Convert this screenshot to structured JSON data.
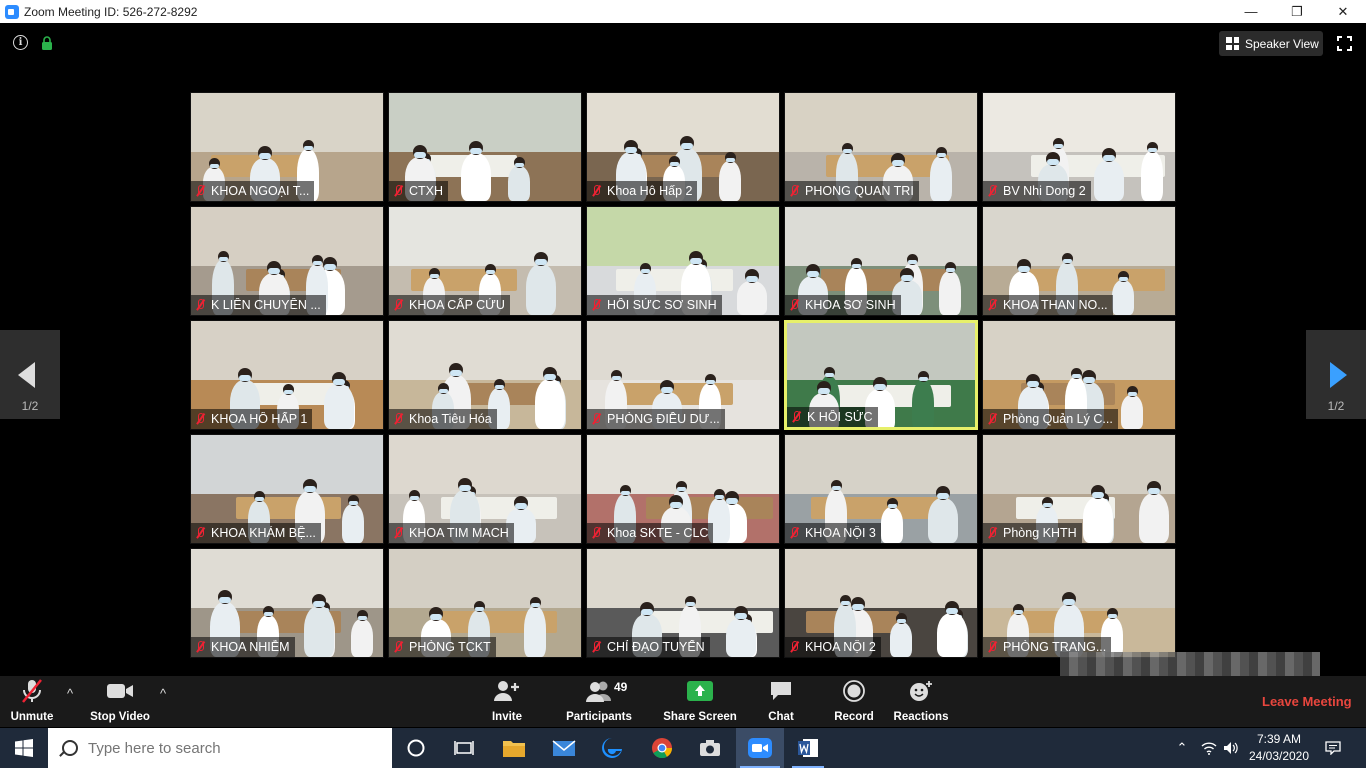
{
  "window": {
    "title": "Zoom Meeting ID: 526-272-8292",
    "controls": [
      "minimize",
      "restore",
      "close"
    ]
  },
  "top_bar": {
    "speaker_view_label": "Speaker View"
  },
  "navigation": {
    "prev_page": "1/2",
    "next_page": "1/2"
  },
  "participants_grid": [
    {
      "name": "KHOA NGOẠI T...",
      "wall": "#d9d4c8",
      "floor": "#b7a58c",
      "muted": true
    },
    {
      "name": "CTXH",
      "wall": "#c9cfc5",
      "floor": "#8d7356",
      "muted": true
    },
    {
      "name": "Khoa Hô Hấp 2",
      "wall": "#e2ddd2",
      "floor": "#7a6650",
      "muted": true
    },
    {
      "name": "PHONG QUAN TRI",
      "wall": "#d8d2c4",
      "floor": "#b9b3aa",
      "muted": true
    },
    {
      "name": "BV Nhi Dong 2",
      "wall": "#ece9e2",
      "floor": "#c5c2bd",
      "muted": true
    },
    {
      "name": "K LIÊN CHUYÊN ...",
      "wall": "#d6cfc3",
      "floor": "#a59b8e",
      "muted": true
    },
    {
      "name": "KHOA CẤP CỨU",
      "wall": "#e5e5e0",
      "floor": "#c4bcaf",
      "muted": true
    },
    {
      "name": "HỒI SỨC SƠ SINH",
      "wall": "#c5d8a8",
      "floor": "#d8dadc",
      "muted": true
    },
    {
      "name": "KHOA SƠ SINH",
      "wall": "#dcdcd6",
      "floor": "#7d8f7a",
      "muted": true
    },
    {
      "name": "KHOA THAN NO...",
      "wall": "#d9d6cd",
      "floor": "#b8ab95",
      "muted": true
    },
    {
      "name": "KHOA HÔ HẤP 1",
      "wall": "#d7d1c6",
      "floor": "#b88a56",
      "muted": true
    },
    {
      "name": "Khoa Tiêu Hóa",
      "wall": "#e0dcd3",
      "floor": "#c7b79a",
      "muted": true
    },
    {
      "name": "PHÒNG ĐIỀU DƯ...",
      "wall": "#dedad2",
      "floor": "#e6e3de",
      "muted": true
    },
    {
      "name": "K HỒI SỨC",
      "wall": "#c3c8bf",
      "floor": "#3f7a4a",
      "muted": true,
      "active": true
    },
    {
      "name": "Phòng Quản Lý C...",
      "wall": "#d7d2c6",
      "floor": "#c49a62",
      "muted": true
    },
    {
      "name": "KHOA KHÁM BỆ...",
      "wall": "#d2d5d6",
      "floor": "#8a7563",
      "muted": true
    },
    {
      "name": "KHOA TIM MACH",
      "wall": "#ddd8cf",
      "floor": "#c7c2ba",
      "muted": true
    },
    {
      "name": "Khoa SKTE - CLC",
      "wall": "#e4e1da",
      "floor": "#b2716a",
      "muted": true
    },
    {
      "name": "KHOA NỘI 3",
      "wall": "#d6d2c8",
      "floor": "#9aa1a4",
      "muted": true
    },
    {
      "name": "Phòng KHTH",
      "wall": "#d3cec3",
      "floor": "#b4a591",
      "muted": true
    },
    {
      "name": "KHOA NHIỄM",
      "wall": "#dfdcd4",
      "floor": "#9e9689",
      "muted": true
    },
    {
      "name": "PHÒNG TCKT",
      "wall": "#d4cfc4",
      "floor": "#b3a890",
      "muted": true
    },
    {
      "name": "CHỈ ĐẠO TUYẾN",
      "wall": "#dcd8ce",
      "floor": "#5a5a5a",
      "muted": true
    },
    {
      "name": "KHOA NỘI 2",
      "wall": "#d9d3c8",
      "floor": "#4a4540",
      "muted": true
    },
    {
      "name": "PHÒNG TRANG...",
      "wall": "#cfc9bd",
      "floor": "#c9b89a",
      "muted": true
    }
  ],
  "toolbar": {
    "unmute": "Unmute",
    "stop_video": "Stop Video",
    "invite": "Invite",
    "participants": "Participants",
    "participants_count": "49",
    "share_screen": "Share Screen",
    "chat": "Chat",
    "record": "Record",
    "reactions": "Reactions",
    "leave": "Leave Meeting"
  },
  "taskbar": {
    "search_placeholder": "Type here to search",
    "time": "7:39 AM",
    "date": "24/03/2020"
  },
  "colors": {
    "accent_blue": "#2d8cff",
    "leave_red": "#e8463e",
    "share_green": "#2bb24c",
    "active_speaker": "#e7f06a"
  }
}
